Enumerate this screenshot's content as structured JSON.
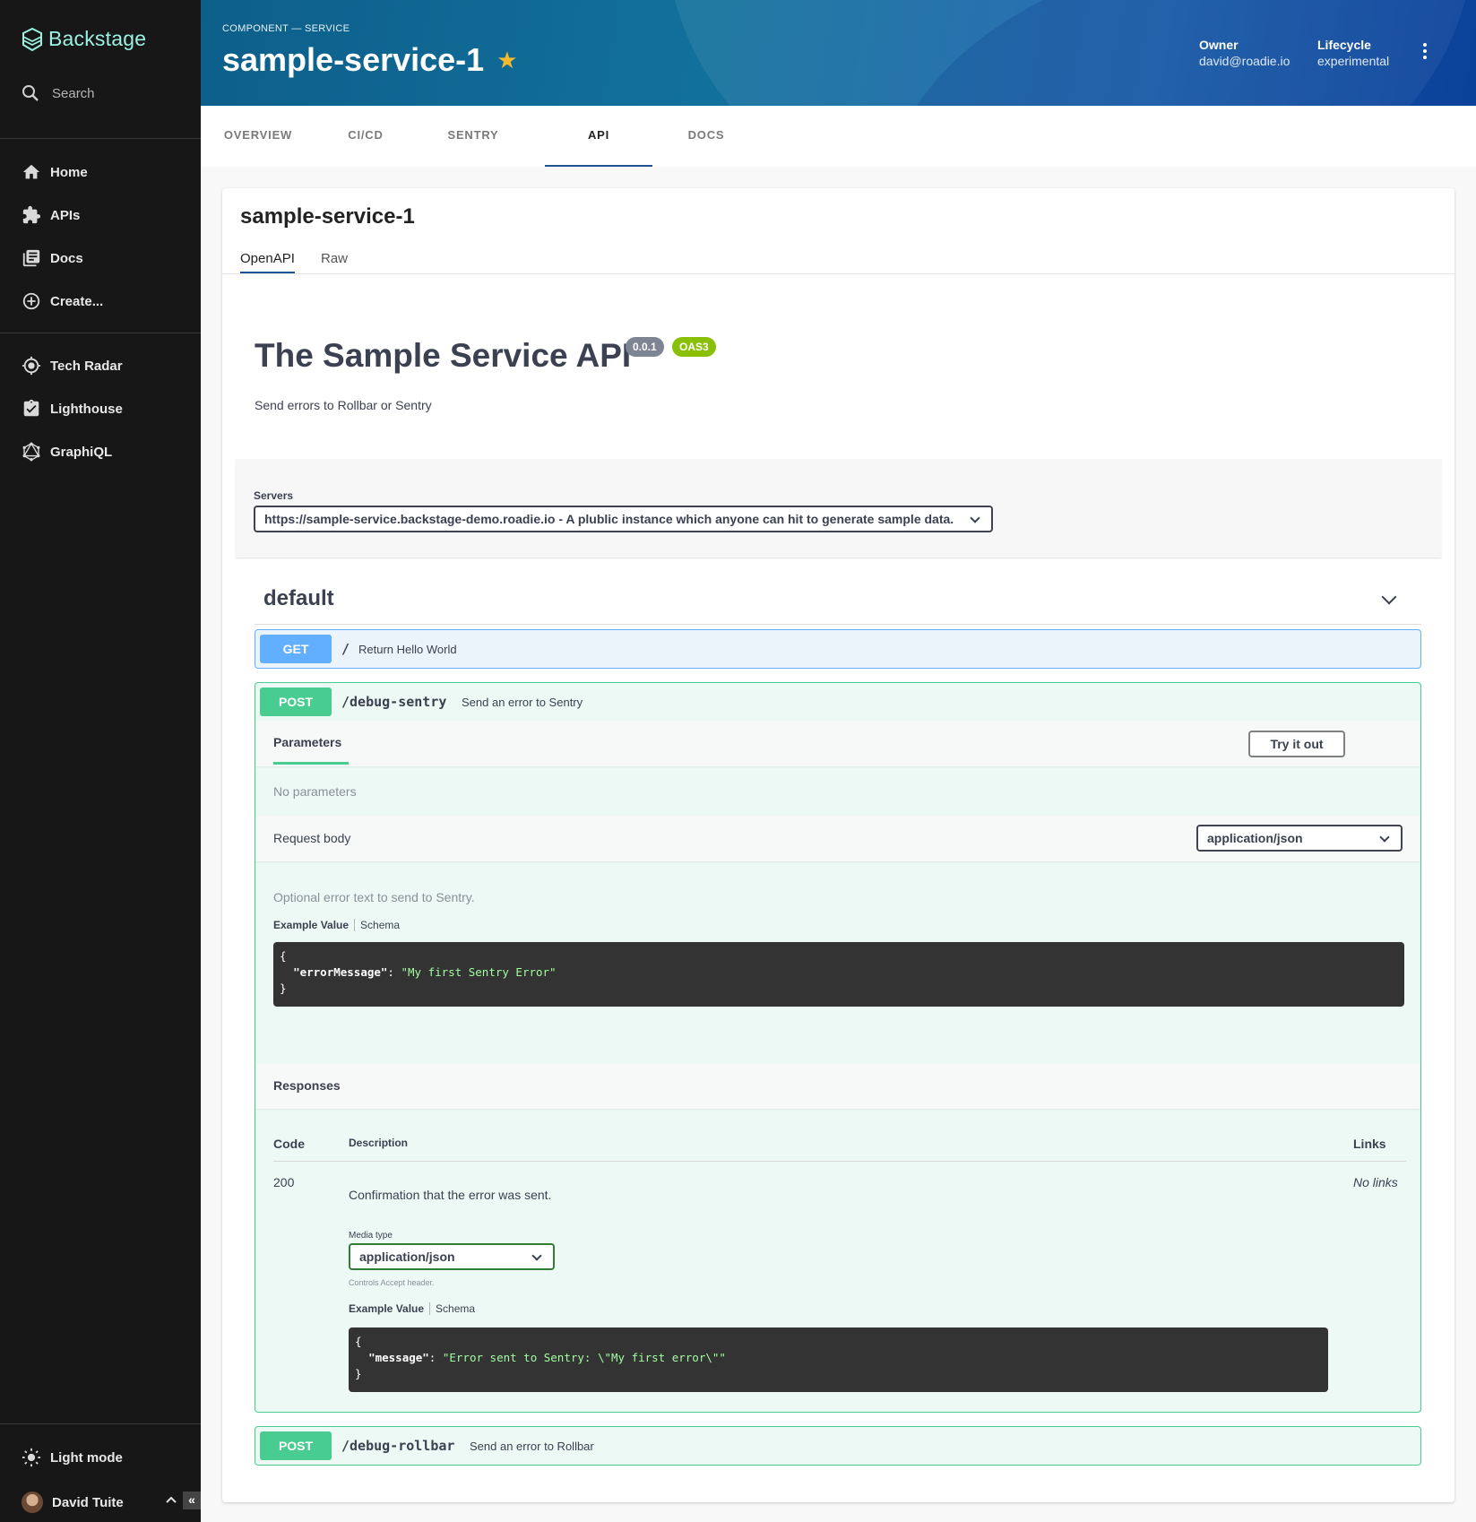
{
  "sidebar": {
    "logo": "Backstage",
    "search": "Search",
    "items": [
      {
        "label": "Home"
      },
      {
        "label": "APIs"
      },
      {
        "label": "Docs"
      },
      {
        "label": "Create..."
      },
      {
        "label": "Tech Radar"
      },
      {
        "label": "Lighthouse"
      },
      {
        "label": "GraphiQL"
      }
    ],
    "light_mode": "Light mode",
    "user": "David Tuite",
    "collapse": "«"
  },
  "header": {
    "breadcrumb": "COMPONENT — SERVICE",
    "title": "sample-service-1",
    "owner_label": "Owner",
    "owner_value": "david@roadie.io",
    "lifecycle_label": "Lifecycle",
    "lifecycle_value": "experimental"
  },
  "tabs": [
    {
      "label": "OVERVIEW"
    },
    {
      "label": "CI/CD"
    },
    {
      "label": "SENTRY"
    },
    {
      "label": "API"
    },
    {
      "label": "DOCS"
    }
  ],
  "card": {
    "title": "sample-service-1",
    "subtabs": [
      {
        "label": "OpenAPI"
      },
      {
        "label": "Raw"
      }
    ]
  },
  "api": {
    "title": "The Sample Service API",
    "version": "0.0.1",
    "oas": "OAS3",
    "description": "Send errors to Rollbar or Sentry",
    "servers_label": "Servers",
    "server_selected": "https://sample-service.backstage-demo.roadie.io - A plublic instance which anyone can hit to generate sample data.",
    "tag": "default"
  },
  "operations": {
    "get": {
      "method": "GET",
      "path": "/",
      "summary": "Return Hello World"
    },
    "debug_sentry": {
      "method": "POST",
      "path": "/debug-sentry",
      "summary": "Send an error to Sentry",
      "parameters_label": "Parameters",
      "try_it_out": "Try it out",
      "no_parameters": "No parameters",
      "request_body_label": "Request body",
      "request_content_type": "application/json",
      "request_description": "Optional error text to send to Sentry.",
      "example_value": "Example Value",
      "schema": "Schema",
      "request_example_open": "{",
      "request_example_key": "\"errorMessage\"",
      "request_example_sep": ": ",
      "request_example_value": "\"My first Sentry Error\"",
      "request_example_close": "}",
      "responses_label": "Responses",
      "col_code": "Code",
      "col_description": "Description",
      "col_links": "Links",
      "response_code": "200",
      "response_description": "Confirmation that the error was sent.",
      "media_type_label": "Media type",
      "media_type_value": "application/json",
      "controls_accept": "Controls Accept header.",
      "response_example_open": "{",
      "response_example_key": "\"message\"",
      "response_example_sep": ": ",
      "response_example_value": "\"Error sent to Sentry: \\\"My first error\\\"\"",
      "response_example_close": "}",
      "no_links": "No links"
    },
    "debug_rollbar": {
      "method": "POST",
      "path": "/debug-rollbar",
      "summary": "Send an error to Rollbar"
    }
  },
  "colors": {
    "sidebar_bg": "#171717",
    "logo": "#9bf0e1",
    "get": "#61affe",
    "post": "#49cc90",
    "version_badge": "#7d8492",
    "oas_badge": "#89bf04",
    "star": "#f5b82e"
  }
}
